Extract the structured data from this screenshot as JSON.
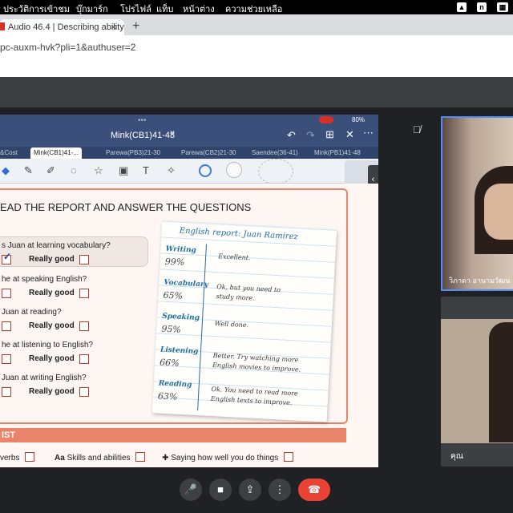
{
  "menubar": {
    "items": [
      "ประวัติการเข้าชม",
      "บุ๊กมาร์ก",
      "โปรไฟล์",
      "แท็บ",
      "หน้าต่าง",
      "ความช่วยเหลือ"
    ],
    "tray_icons": [
      "a-icon",
      "n-icon"
    ]
  },
  "browser": {
    "tab_title": "Audio 46.4 | Describing ability",
    "close_glyph": "×",
    "new_tab_glyph": "+",
    "url": "pc-auxm-hvk?pli=1&authuser=2"
  },
  "goodnotes": {
    "doc_title": "Mink(CB1)41-48",
    "title_chevron": "˅",
    "battery": "80%",
    "tabs": [
      "&Cost",
      "Mink(CB1)41-...",
      "Parewa(PB3)21-30",
      "Parewa(CB2)21-30",
      "Saendee(36-41)",
      "Mink(PB1)41-48"
    ],
    "active_tab_index": 1
  },
  "worksheet": {
    "section_title": "EAD THE REPORT AND ANSWER THE QUESTIONS",
    "questions": [
      {
        "text": "s Juan at learning vocabulary?",
        "option": "Really good",
        "checked": true
      },
      {
        "text": " he at speaking English?",
        "option": "Really good",
        "checked": false
      },
      {
        "text": " Juan at reading?",
        "option": "Really good",
        "checked": false
      },
      {
        "text": " he at listening to English?",
        "option": "Really good",
        "checked": false
      },
      {
        "text": " Juan at writing English?",
        "option": "Really good",
        "checked": false
      }
    ],
    "report": {
      "title": "English report: Juan Ramirez",
      "rows": [
        {
          "skill": "Writing",
          "score": "99%",
          "comment": [
            "Excellent."
          ]
        },
        {
          "skill": "Vocabulary",
          "score": "65%",
          "comment": [
            "Ok, but you need to",
            "study more."
          ]
        },
        {
          "skill": "Speaking",
          "score": "95%",
          "comment": [
            "Well done."
          ]
        },
        {
          "skill": "Listening",
          "score": "66%",
          "comment": [
            "Better. Try watching more",
            "English movies to improve."
          ]
        },
        {
          "skill": "Reading",
          "score": "63%",
          "comment": [
            "Ok. You need to read more",
            "English texts to improve."
          ]
        }
      ]
    },
    "checklist_title": "IST",
    "checklist_items": [
      "verbs",
      "Skills and abilities",
      "Saying how well you do things"
    ],
    "checklist_prefix": "Aa"
  },
  "meet": {
    "participants": [
      {
        "name": "วิภาดา อานามวัฒน"
      },
      {
        "name": "คุณ"
      }
    ]
  },
  "colors": {
    "accent_orange": "#e9846a",
    "checkbox_red": "#c0392b",
    "leave_red": "#ea4335",
    "speaking_blue": "#4f8ff7",
    "report_blue": "#1f6fa3"
  }
}
